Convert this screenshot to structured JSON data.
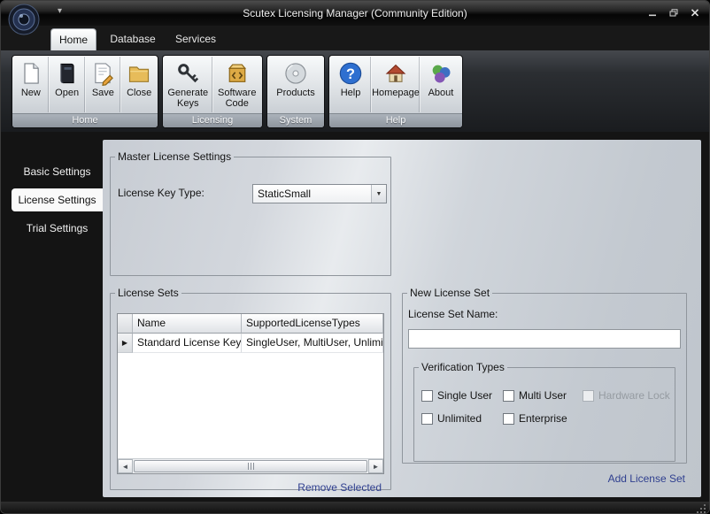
{
  "window": {
    "title": "Scutex Licensing Manager (Community Edition)"
  },
  "ribbon": {
    "tabs": [
      {
        "label": "Home",
        "active": true
      },
      {
        "label": "Database",
        "active": false
      },
      {
        "label": "Services",
        "active": false
      }
    ],
    "groups": [
      {
        "label": "Home",
        "buttons": [
          "New",
          "Open",
          "Save",
          "Close"
        ]
      },
      {
        "label": "Licensing",
        "buttons": [
          "Generate Keys",
          "Software Code"
        ]
      },
      {
        "label": "System",
        "buttons": [
          "Products"
        ]
      },
      {
        "label": "Help",
        "buttons": [
          "Help",
          "Homepage",
          "About"
        ]
      }
    ]
  },
  "sidebar": {
    "items": [
      {
        "label": "Basic Settings",
        "active": false
      },
      {
        "label": "License Settings",
        "active": true
      },
      {
        "label": "Trial Settings",
        "active": false
      }
    ]
  },
  "master": {
    "group_title": "Master License Settings",
    "key_type_label": "License Key Type:",
    "key_type_value": "StaticSmall"
  },
  "license_sets": {
    "group_title": "License Sets",
    "columns": [
      "Name",
      "SupportedLicenseTypes"
    ],
    "rows": [
      [
        "Standard License Key",
        "SingleUser, MultiUser, Unlimite"
      ]
    ],
    "remove_link": "Remove Selected"
  },
  "new_license_set": {
    "group_title": "New License Set",
    "name_label": "License Set Name:",
    "name_value": "",
    "verification": {
      "group_title": "Verification Types",
      "options": [
        {
          "label": "Single User",
          "checked": false,
          "disabled": false
        },
        {
          "label": "Multi User",
          "checked": false,
          "disabled": false
        },
        {
          "label": "Hardware Lock",
          "checked": false,
          "disabled": true
        },
        {
          "label": "Unlimited",
          "checked": false,
          "disabled": false
        },
        {
          "label": "Enterprise",
          "checked": false,
          "disabled": false
        }
      ]
    },
    "add_link": "Add License Set"
  },
  "glyphs": {
    "qat_arrow": "▾",
    "combo_arrow": "▼",
    "row_marker": "▶",
    "scroll_left": "◄",
    "scroll_right": "►"
  },
  "colors": {
    "link": "#2f3f8f",
    "active_tab": "#ffffff",
    "panel": "#d3d7dd"
  }
}
